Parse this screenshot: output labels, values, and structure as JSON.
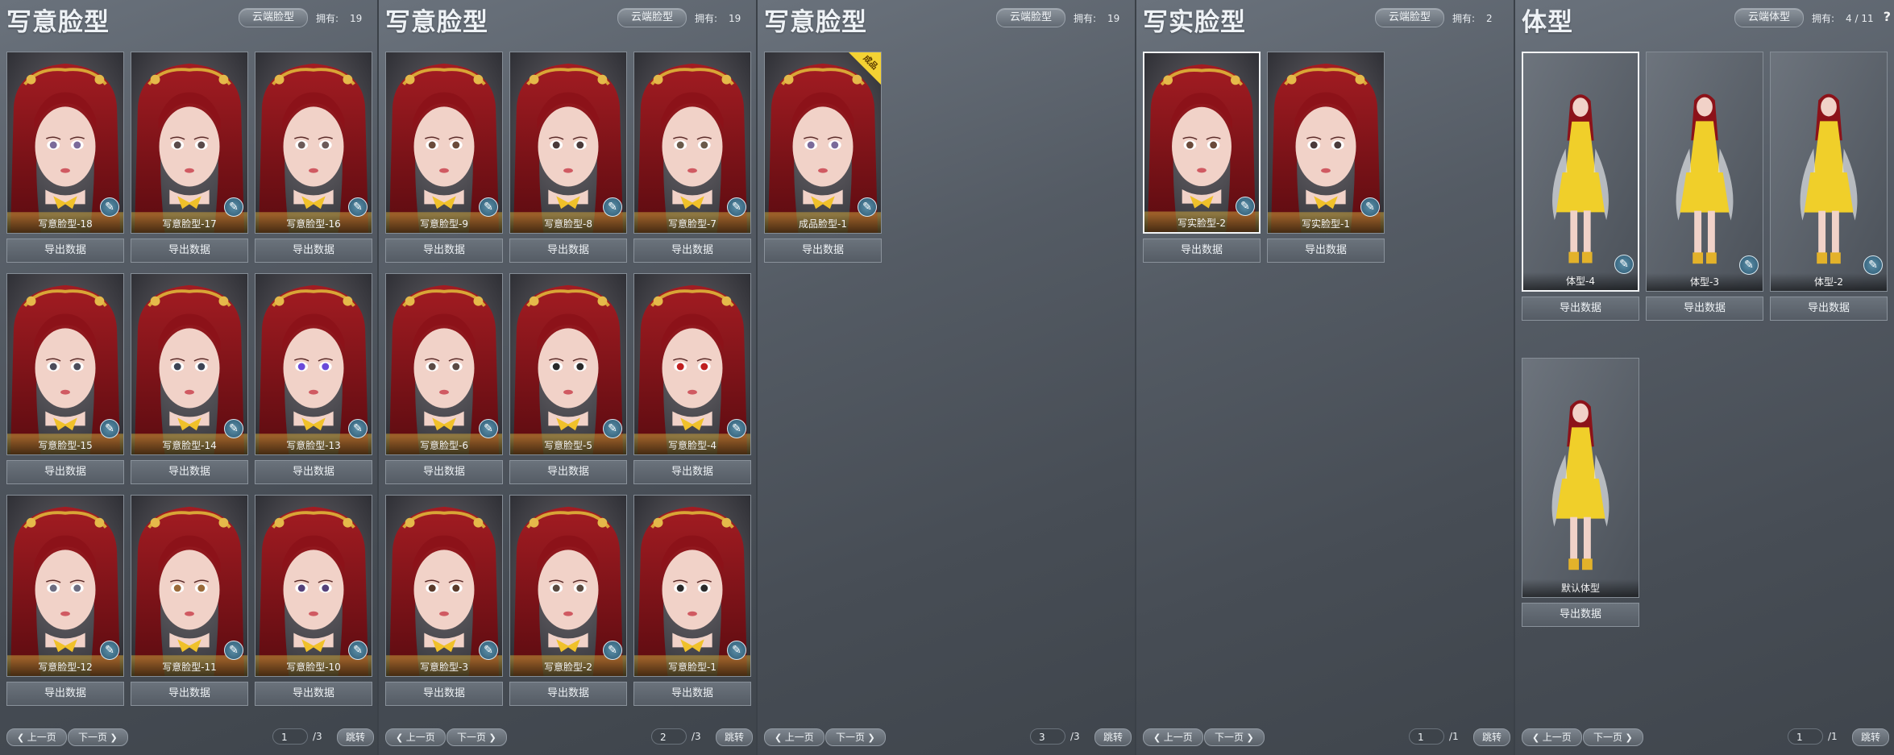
{
  "panels": [
    {
      "title": "写意脸型",
      "cloud": "云端脸型",
      "owned_label": "拥有:",
      "owned": "19",
      "cards": [
        "写意脸型-18",
        "写意脸型-17",
        "写意脸型-16",
        "写意脸型-15",
        "写意脸型-14",
        "写意脸型-13",
        "写意脸型-12",
        "写意脸型-11",
        "写意脸型-10"
      ],
      "page": "1",
      "total": "/3"
    },
    {
      "title": "写意脸型",
      "cloud": "云端脸型",
      "owned_label": "拥有:",
      "owned": "19",
      "cards": [
        "写意脸型-9",
        "写意脸型-8",
        "写意脸型-7",
        "写意脸型-6",
        "写意脸型-5",
        "写意脸型-4",
        "写意脸型-3",
        "写意脸型-2",
        "写意脸型-1"
      ],
      "page": "2",
      "total": "/3"
    },
    {
      "title": "写意脸型",
      "cloud": "云端脸型",
      "owned_label": "拥有:",
      "owned": "19",
      "cards": [
        "成品脸型-1"
      ],
      "badge": "成品",
      "page": "3",
      "total": "/3"
    },
    {
      "title": "写实脸型",
      "cloud": "云端脸型",
      "owned_label": "拥有:",
      "owned": "2",
      "cards": [
        "写实脸型-2",
        "写实脸型-1"
      ],
      "page": "1",
      "total": "/1"
    },
    {
      "title": "体型",
      "cloud": "云端体型",
      "owned_label": "拥有:",
      "owned": "4 / 11",
      "cards": [
        "体型-4",
        "体型-3",
        "体型-2",
        "默认体型"
      ],
      "page": "1",
      "total": "/1",
      "help": "?"
    }
  ],
  "common": {
    "export": "导出数据",
    "prev": "上一页",
    "next": "下一页",
    "jump": "跳转"
  },
  "colors": {
    "hair": "#8c1219",
    "skin": "#f1d2c8",
    "gold": "#d9a536",
    "dress": "#f0cf2a"
  },
  "icons": {
    "brush": "brush-icon",
    "prev": "chevron-left-icon",
    "next": "chevron-right-icon"
  }
}
